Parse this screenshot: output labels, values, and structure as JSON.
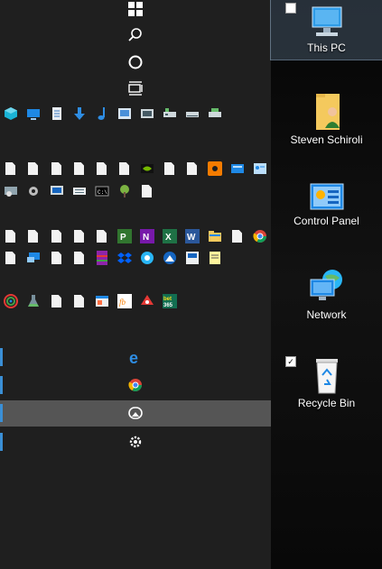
{
  "desktop": {
    "icons": [
      {
        "name": "this-pc",
        "label": "This PC"
      },
      {
        "name": "user-folder",
        "label": "Steven Schiroli"
      },
      {
        "name": "control-panel",
        "label": "Control Panel"
      },
      {
        "name": "network",
        "label": "Network"
      },
      {
        "name": "recycle-bin",
        "label": "Recycle Bin"
      }
    ]
  },
  "colors": {
    "accent": "#3a8fd6",
    "menu_bg": "#1f1f1f",
    "active_row": "#555555"
  }
}
